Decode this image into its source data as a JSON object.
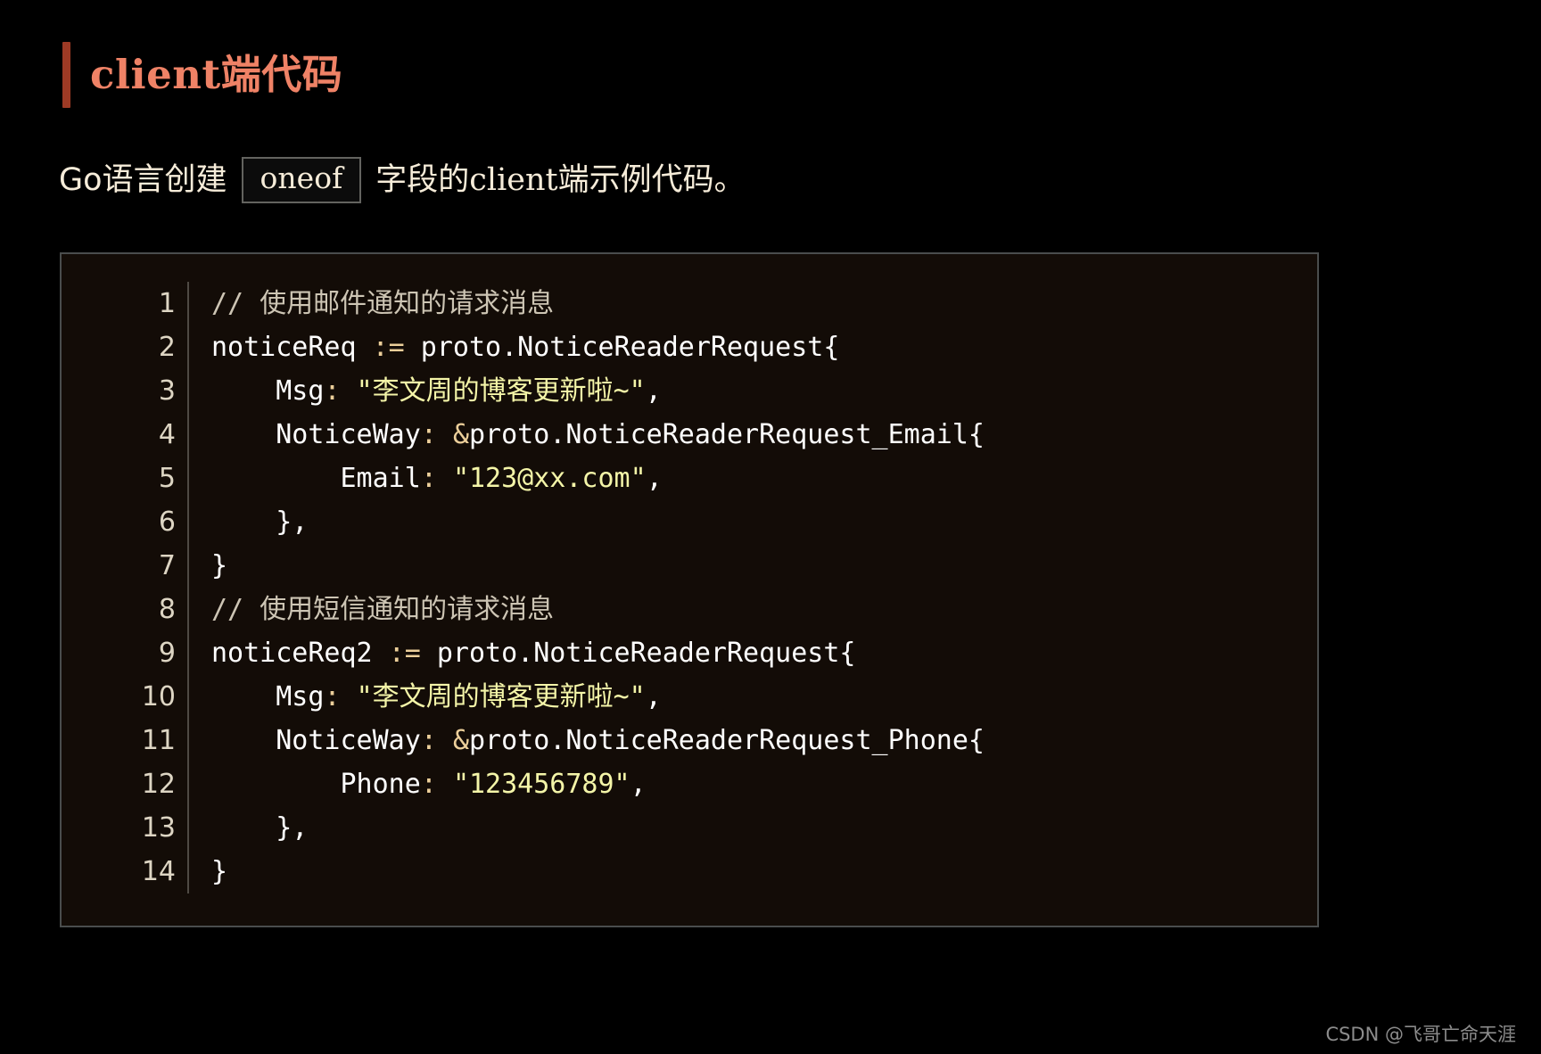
{
  "heading": {
    "text": "client端代码",
    "accent_bar_color": "#9e3a25",
    "text_color": "#ef8266"
  },
  "subtitle": {
    "before": "Go语言创建",
    "code_chip": "oneof",
    "after_1": "字段的",
    "after_serif": "client",
    "after_2": "端示例代码。"
  },
  "code_block": {
    "background_color": "#130c07",
    "border_color": "#4a4d4d",
    "line_numbers": [
      "1",
      "2",
      "3",
      "4",
      "5",
      "6",
      "7",
      "8",
      "9",
      "10",
      "11",
      "12",
      "13",
      "14"
    ],
    "lines": [
      {
        "n": "1",
        "tokens": [
          {
            "t": "comment",
            "v": "// 使用邮件通知的请求消息"
          }
        ]
      },
      {
        "n": "2",
        "tokens": [
          {
            "t": "plain",
            "v": "noticeReq "
          },
          {
            "t": "op",
            "v": ":="
          },
          {
            "t": "plain",
            "v": " proto.NoticeReaderRequest{"
          }
        ]
      },
      {
        "n": "3",
        "tokens": [
          {
            "t": "plain",
            "v": "    Msg"
          },
          {
            "t": "op",
            "v": ":"
          },
          {
            "t": "plain",
            "v": " "
          },
          {
            "t": "string",
            "v": "\"李文周的博客更新啦~\""
          },
          {
            "t": "punct",
            "v": ","
          }
        ]
      },
      {
        "n": "4",
        "tokens": [
          {
            "t": "plain",
            "v": "    NoticeWay"
          },
          {
            "t": "op",
            "v": ":"
          },
          {
            "t": "plain",
            "v": " "
          },
          {
            "t": "op",
            "v": "&"
          },
          {
            "t": "plain",
            "v": "proto.NoticeReaderRequest_Email{"
          }
        ]
      },
      {
        "n": "5",
        "tokens": [
          {
            "t": "plain",
            "v": "        Email"
          },
          {
            "t": "op",
            "v": ":"
          },
          {
            "t": "plain",
            "v": " "
          },
          {
            "t": "string",
            "v": "\"123@xx.com\""
          },
          {
            "t": "punct",
            "v": ","
          }
        ]
      },
      {
        "n": "6",
        "tokens": [
          {
            "t": "plain",
            "v": "    },"
          }
        ]
      },
      {
        "n": "7",
        "tokens": [
          {
            "t": "plain",
            "v": "}"
          }
        ]
      },
      {
        "n": "8",
        "tokens": [
          {
            "t": "comment",
            "v": "// 使用短信通知的请求消息"
          }
        ]
      },
      {
        "n": "9",
        "tokens": [
          {
            "t": "plain",
            "v": "noticeReq2 "
          },
          {
            "t": "op",
            "v": ":="
          },
          {
            "t": "plain",
            "v": " proto.NoticeReaderRequest{"
          }
        ]
      },
      {
        "n": "10",
        "tokens": [
          {
            "t": "plain",
            "v": "    Msg"
          },
          {
            "t": "op",
            "v": ":"
          },
          {
            "t": "plain",
            "v": " "
          },
          {
            "t": "string",
            "v": "\"李文周的博客更新啦~\""
          },
          {
            "t": "punct",
            "v": ","
          }
        ]
      },
      {
        "n": "11",
        "tokens": [
          {
            "t": "plain",
            "v": "    NoticeWay"
          },
          {
            "t": "op",
            "v": ":"
          },
          {
            "t": "plain",
            "v": " "
          },
          {
            "t": "op",
            "v": "&"
          },
          {
            "t": "plain",
            "v": "proto.NoticeReaderRequest_Phone{"
          }
        ]
      },
      {
        "n": "12",
        "tokens": [
          {
            "t": "plain",
            "v": "        Phone"
          },
          {
            "t": "op",
            "v": ":"
          },
          {
            "t": "plain",
            "v": " "
          },
          {
            "t": "string",
            "v": "\"123456789\""
          },
          {
            "t": "punct",
            "v": ","
          }
        ]
      },
      {
        "n": "13",
        "tokens": [
          {
            "t": "plain",
            "v": "    },"
          }
        ]
      },
      {
        "n": "14",
        "tokens": [
          {
            "t": "plain",
            "v": "}"
          }
        ]
      }
    ]
  },
  "watermark": {
    "text": "CSDN @飞哥亡命天涯"
  }
}
